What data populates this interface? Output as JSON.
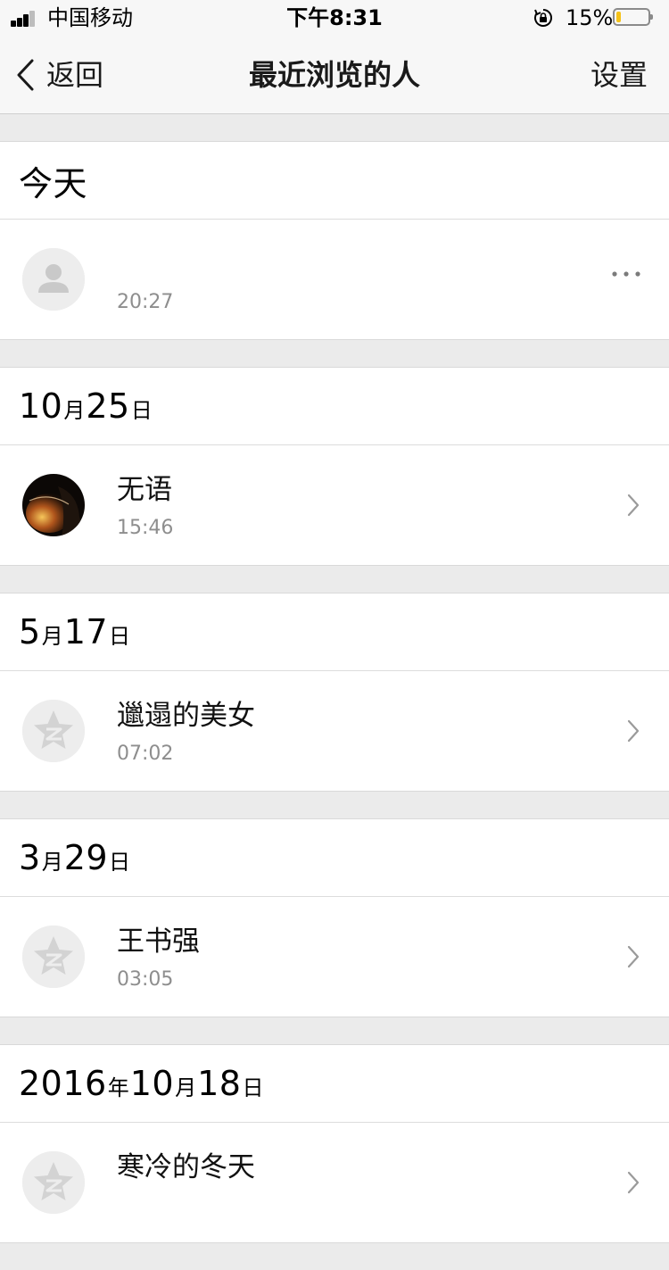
{
  "status_bar": {
    "carrier": "中国移动",
    "time": "下午8:31",
    "battery_percent": "15%",
    "battery_level": 0.15,
    "battery_color": "#f5c218"
  },
  "nav": {
    "back_label": "返回",
    "title": "最近浏览的人",
    "settings_label": "设置"
  },
  "sections": [
    {
      "date_parts": [
        {
          "text": "今天",
          "size": "big"
        }
      ],
      "rows": [
        {
          "name": "",
          "time": "20:27",
          "avatar": "default-person-icon",
          "action": "more-icon"
        }
      ]
    },
    {
      "date_parts": [
        {
          "text": "10",
          "size": "big"
        },
        {
          "text": "月",
          "size": "small"
        },
        {
          "text": "25",
          "size": "big"
        },
        {
          "text": "日",
          "size": "small"
        }
      ],
      "rows": [
        {
          "name": "无语",
          "time": "15:46",
          "avatar": "photo-avatar",
          "action": "chevron-right-icon"
        }
      ]
    },
    {
      "date_parts": [
        {
          "text": "5",
          "size": "big"
        },
        {
          "text": "月",
          "size": "small"
        },
        {
          "text": "17",
          "size": "big"
        },
        {
          "text": "日",
          "size": "small"
        }
      ],
      "rows": [
        {
          "name": "邋遢的美女",
          "time": "07:02",
          "avatar": "qzone-star-icon",
          "action": "chevron-right-icon"
        }
      ]
    },
    {
      "date_parts": [
        {
          "text": "3",
          "size": "big"
        },
        {
          "text": "月",
          "size": "small"
        },
        {
          "text": "29",
          "size": "big"
        },
        {
          "text": "日",
          "size": "small"
        }
      ],
      "rows": [
        {
          "name": "王书强",
          "time": "03:05",
          "avatar": "qzone-star-icon",
          "action": "chevron-right-icon"
        }
      ]
    },
    {
      "date_parts": [
        {
          "text": "2016",
          "size": "big"
        },
        {
          "text": "年",
          "size": "small"
        },
        {
          "text": "10",
          "size": "big"
        },
        {
          "text": "月",
          "size": "small"
        },
        {
          "text": "18",
          "size": "big"
        },
        {
          "text": "日",
          "size": "small"
        }
      ],
      "rows": [
        {
          "name": "寒冷的冬天",
          "time": "",
          "avatar": "qzone-star-icon",
          "action": "chevron-right-icon"
        }
      ]
    }
  ]
}
